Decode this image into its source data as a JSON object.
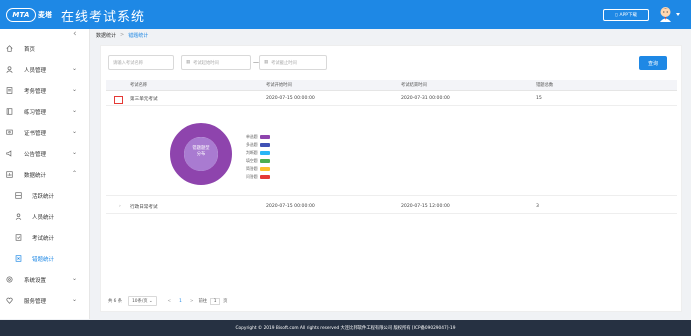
{
  "header": {
    "logo_text": "MTA",
    "logo_name": "麦塔",
    "title": "在线考试系统",
    "app_download": "APP下载"
  },
  "sidebar": {
    "items": [
      {
        "label": "首页",
        "icon": "home-icon"
      },
      {
        "label": "人员管理",
        "icon": "user-icon"
      },
      {
        "label": "考务管理",
        "icon": "document-icon"
      },
      {
        "label": "练习管理",
        "icon": "book-icon"
      },
      {
        "label": "证书管理",
        "icon": "certificate-icon"
      },
      {
        "label": "公告管理",
        "icon": "notice-icon"
      },
      {
        "label": "数据统计",
        "icon": "chart-icon",
        "open": true
      },
      {
        "label": "活跃统计",
        "icon": "activity-icon",
        "sub": true
      },
      {
        "label": "人员统计",
        "icon": "person-icon",
        "sub": true
      },
      {
        "label": "考试统计",
        "icon": "exam-icon",
        "sub": true
      },
      {
        "label": "错题统计",
        "icon": "error-icon",
        "sub": true,
        "active": true
      },
      {
        "label": "系统设置",
        "icon": "settings-icon"
      },
      {
        "label": "服务管理",
        "icon": "service-icon"
      }
    ]
  },
  "breadcrumb": {
    "parent": "数据统计",
    "separator": ">",
    "current": "错题统计"
  },
  "filters": {
    "name_placeholder": "请输入考试名称",
    "start_placeholder": "考试起始时间",
    "end_placeholder": "考试截止时间",
    "dash": "—",
    "search_label": "查询"
  },
  "table": {
    "columns": [
      "考试名称",
      "考试开始时间",
      "考试结束时间",
      "错题总数"
    ],
    "rows": [
      {
        "name": "第三单元考试",
        "start": "2020-07-15 00:00:00",
        "end": "2020-07-31 00:00:00",
        "count": "15"
      },
      {
        "name": "行政日常考试",
        "start": "2020-07-15 00:00:00",
        "end": "2020-07-15 12:00:00",
        "count": "3"
      }
    ]
  },
  "chart_data": {
    "type": "pie",
    "center_label": [
      "错题题型",
      "分布"
    ],
    "categories": [
      "单选题",
      "多选题",
      "判断题",
      "填空题",
      "简答题",
      "问答题"
    ],
    "values": [
      15
    ],
    "colors": [
      "#8e44ad",
      "#3f51b5",
      "#29b6f6",
      "#4caf50",
      "#fbc02d",
      "#e53935"
    ]
  },
  "pager": {
    "total": "共 6 条",
    "page_size": "10条/页",
    "prev": "<",
    "page": "1",
    "next": ">",
    "goto_label": "前往",
    "goto_value": "1",
    "page_suffix": "页"
  },
  "footer": {
    "copyright": "Copyright © 2019 Bisoft.com All rights reserved 大连比邦软件工程有限公司 版权所有 [ICP备09029047]-19"
  }
}
